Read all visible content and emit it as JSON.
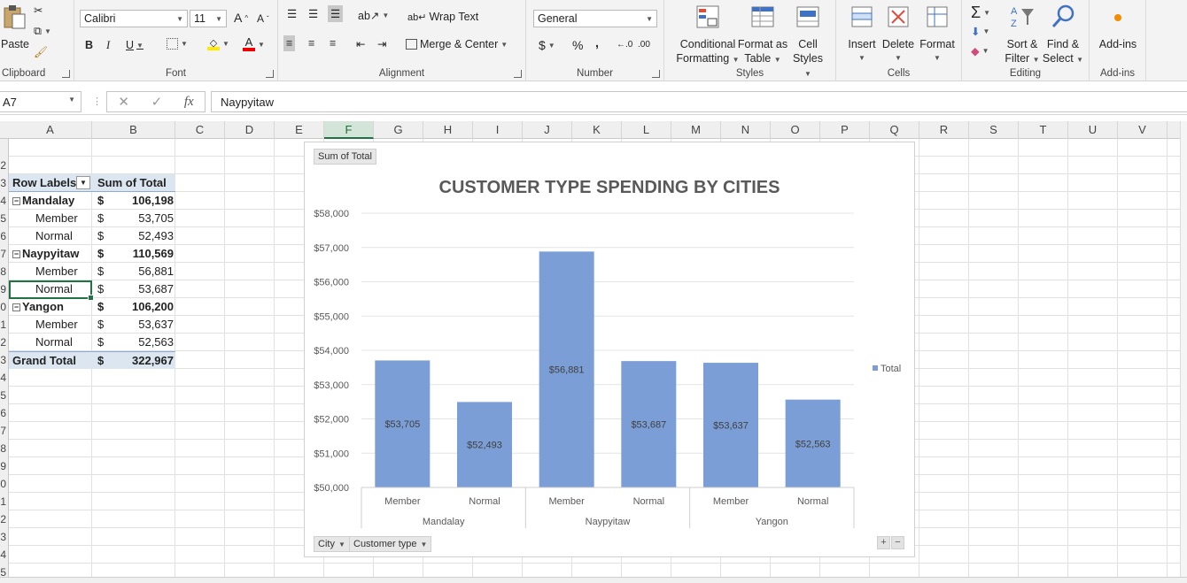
{
  "ribbon": {
    "clipboard": {
      "paste_label": "Paste",
      "group_label": "Clipboard"
    },
    "font": {
      "name": "Calibri",
      "size": "11",
      "group_label": "Font",
      "bold": "B",
      "italic": "I",
      "underline": "U",
      "grow": "A",
      "shrink": "A"
    },
    "alignment": {
      "wrap_text": "Wrap Text",
      "merge_center": "Merge & Center",
      "group_label": "Alignment"
    },
    "number": {
      "format": "General",
      "currency": "$",
      "percent": "%",
      "comma": ",",
      "group_label": "Number"
    },
    "styles": {
      "conditional": [
        "Conditional",
        "Formatting"
      ],
      "format_as_table": [
        "Format as",
        "Table"
      ],
      "cell_styles": [
        "Cell",
        "Styles"
      ],
      "group_label": "Styles"
    },
    "cells": {
      "insert": "Insert",
      "delete": "Delete",
      "format": "Format",
      "group_label": "Cells"
    },
    "editing": {
      "sort_filter": [
        "Sort &",
        "Filter"
      ],
      "find_select": [
        "Find &",
        "Select"
      ],
      "group_label": "Editing"
    },
    "addins": {
      "label": "Add-ins",
      "group_label": "Add-ins"
    }
  },
  "formula_bar": {
    "name_box": "A7",
    "fx": "fx",
    "value": "Naypyitaw"
  },
  "columns": [
    "A",
    "B",
    "C",
    "D",
    "E",
    "F",
    "G",
    "H",
    "I",
    "J",
    "K",
    "L",
    "M",
    "N",
    "O",
    "P",
    "Q",
    "R",
    "S",
    "T",
    "U",
    "V"
  ],
  "selected_column": "F",
  "rows": [
    "2",
    "3",
    "4",
    "5",
    "6",
    "7",
    "8",
    "9",
    "0",
    "1",
    "2",
    "3",
    "4",
    "5",
    "6",
    "7",
    "8",
    "9",
    "0",
    "1",
    "2",
    "3",
    "4",
    "5"
  ],
  "pivot": {
    "header": {
      "label": "Row Labels",
      "value": "Sum of Total"
    },
    "rows": [
      {
        "label": "Mandalay",
        "dollar": "$",
        "value": "106,198",
        "level": 0
      },
      {
        "label": "Member",
        "dollar": "$",
        "value": "53,705",
        "level": 1
      },
      {
        "label": "Normal",
        "dollar": "$",
        "value": "52,493",
        "level": 1
      },
      {
        "label": "Naypyitaw",
        "dollar": "$",
        "value": "110,569",
        "level": 0
      },
      {
        "label": "Member",
        "dollar": "$",
        "value": "56,881",
        "level": 1
      },
      {
        "label": "Normal",
        "dollar": "$",
        "value": "53,687",
        "level": 1
      },
      {
        "label": "Yangon",
        "dollar": "$",
        "value": "106,200",
        "level": 0
      },
      {
        "label": "Member",
        "dollar": "$",
        "value": "53,637",
        "level": 1
      },
      {
        "label": "Normal",
        "dollar": "$",
        "value": "52,563",
        "level": 1
      }
    ],
    "grand_total": {
      "label": "Grand Total",
      "dollar": "$",
      "value": "322,967"
    }
  },
  "chart_buttons": {
    "value_field": "Sum of Total",
    "axis_field_1": "City",
    "axis_field_2": "Customer type",
    "plus": "+",
    "minus": "−"
  },
  "chart_data": {
    "type": "bar",
    "title": "CUSTOMER TYPE SPENDING BY CITIES",
    "groups": [
      "Mandalay",
      "Naypyitaw",
      "Yangon"
    ],
    "categories": [
      "Member",
      "Normal",
      "Member",
      "Normal",
      "Member",
      "Normal"
    ],
    "category_groups": [
      0,
      0,
      1,
      1,
      2,
      2
    ],
    "series": [
      {
        "name": "Total",
        "values": [
          53705,
          52493,
          56881,
          53687,
          53637,
          52563
        ],
        "color": "#7b9ed6"
      }
    ],
    "data_labels": [
      "$53,705",
      "$52,493",
      "$56,881",
      "$53,687",
      "$53,637",
      "$52,563"
    ],
    "ylim": [
      50000,
      58000
    ],
    "yticks": [
      "$50,000",
      "$51,000",
      "$52,000",
      "$53,000",
      "$54,000",
      "$55,000",
      "$56,000",
      "$57,000",
      "$58,000"
    ],
    "grid": true,
    "legend": "right"
  }
}
